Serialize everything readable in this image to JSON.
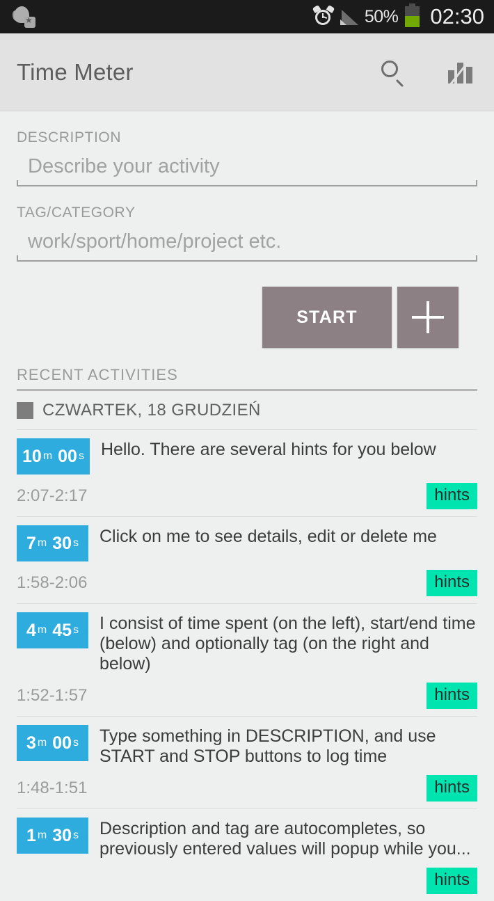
{
  "statusbar": {
    "notification_icon": "app-notification-icon",
    "alarm_icon": "alarm-clock-icon",
    "signal_icon": "cell-signal-icon",
    "battery_percent": "50%",
    "battery_icon": "battery-half-icon",
    "clock": "02:30"
  },
  "appbar": {
    "title": "Time Meter",
    "search_icon": "search-icon",
    "stats_icon": "bar-chart-icon"
  },
  "form": {
    "description": {
      "label": "DESCRIPTION",
      "placeholder": "Describe your activity",
      "value": ""
    },
    "tag": {
      "label": "TAG/CATEGORY",
      "placeholder": "work/sport/home/project etc.",
      "value": ""
    },
    "start_label": "START",
    "add_label": "+"
  },
  "recent": {
    "section_title": "RECENT ACTIVITIES",
    "day_label": "CZWARTEK, 18 GRUDZIEŃ",
    "day_color": "#7d7d7d",
    "activities": [
      {
        "minutes": "10",
        "minutes_unit": "m",
        "seconds": "00",
        "seconds_unit": "s",
        "description": "Hello. There are several hints for you below",
        "time_range": "2:07-2:17",
        "tag": "hints"
      },
      {
        "minutes": "7",
        "minutes_unit": "m",
        "seconds": "30",
        "seconds_unit": "s",
        "description": "Click on me to see details, edit or delete me",
        "time_range": "1:58-2:06",
        "tag": "hints"
      },
      {
        "minutes": "4",
        "minutes_unit": "m",
        "seconds": "45",
        "seconds_unit": "s",
        "description": "I consist of time spent (on the left), start/end time (below) and optionally tag (on the right and below)",
        "time_range": "1:52-1:57",
        "tag": "hints"
      },
      {
        "minutes": "3",
        "minutes_unit": "m",
        "seconds": "00",
        "seconds_unit": "s",
        "description": "Type something in DESCRIPTION, and use START and STOP buttons to log time",
        "time_range": "1:48-1:51",
        "tag": "hints"
      },
      {
        "minutes": "1",
        "minutes_unit": "m",
        "seconds": "30",
        "seconds_unit": "s",
        "description": "Description and tag are autocompletes, so previously entered values will popup while you...",
        "time_range": "",
        "tag": "hints"
      }
    ]
  },
  "colors": {
    "duration_badge": "#2facde",
    "tag_badge": "#00e5b0",
    "button": "#8d8085",
    "appbar": "#e2e2e2",
    "background": "#eeefef"
  }
}
